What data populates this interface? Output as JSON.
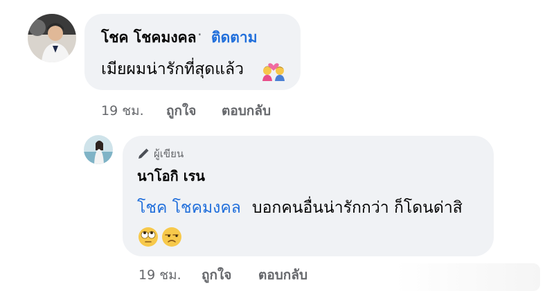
{
  "comment": {
    "author": "โชค โชคมงคล",
    "separator": "·",
    "follow_label": "ติดตาม",
    "text": "เมียผมน่ารักที่สุดแล้ว",
    "emoji": "couple-with-heart-icon",
    "time": "19 ชม.",
    "like_label": "ถูกใจ",
    "reply_label": "ตอบกลับ"
  },
  "reply": {
    "badge_label": "ผู้เขียน",
    "author": "นาโอกิ เรน",
    "mention": "โชค โชคมงคล",
    "text": "บอกคนอื่นน่ารักกว่า ก็โดนด่าสิ",
    "emojis": [
      "face-with-rolling-eyes-icon",
      "unamused-face-icon"
    ],
    "time": "19 ชม.",
    "like_label": "ถูกใจ",
    "reply_label": "ตอบกลับ"
  },
  "colors": {
    "bubble": "#f0f2f5",
    "link": "#216fdb",
    "meta": "#65676b"
  }
}
